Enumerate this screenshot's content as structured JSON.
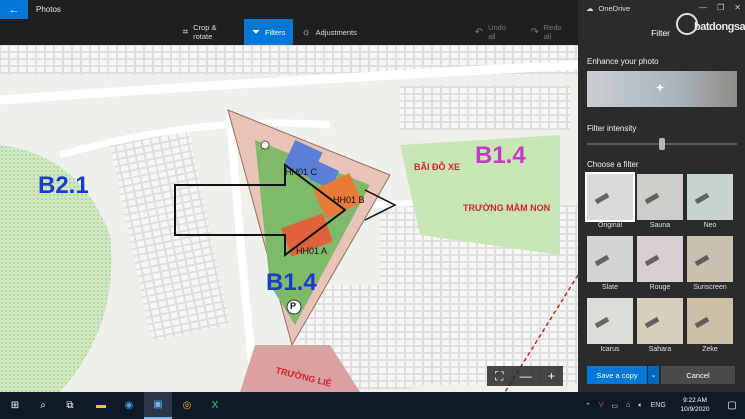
{
  "window": {
    "app_title": "Photos"
  },
  "toolbar": {
    "crop_label": "Crop & rotate",
    "filters_label": "Filters",
    "adjustments_label": "Adjustments",
    "undo_label": "Undo all",
    "redo_label": "Redo all"
  },
  "map": {
    "label_b21": "B2.1",
    "label_b14_top": "B1.4",
    "label_b14_bottom": "B1.4",
    "parking": "BÃI ĐỖ XE",
    "school": "TRƯỜNG MẦM NON",
    "school_bottom": "TRƯỜNG LIÊ",
    "hh01c": "HH01 C",
    "hh01b": "HH01 B",
    "hh01a": "HH01 A",
    "parking_symbol": "P"
  },
  "zoom": {
    "fit": "⛶",
    "minus": "—",
    "plus": "+"
  },
  "panel": {
    "onedrive": "OneDrive",
    "title": "Filter",
    "watermark": "batdongsan",
    "enhance_label": "Enhance your photo",
    "intensity_label": "Filter intensity",
    "intensity_value": 0.5,
    "choose_label": "Choose a filter",
    "filters": [
      {
        "name": "Original",
        "selected": true,
        "tint": "#d8dbd9"
      },
      {
        "name": "Sauna",
        "selected": false,
        "tint": "#cfcdca"
      },
      {
        "name": "Neo",
        "selected": false,
        "tint": "#c9d3ce"
      },
      {
        "name": "Slate",
        "selected": false,
        "tint": "#d2d5d4"
      },
      {
        "name": "Rouge",
        "selected": false,
        "tint": "#d7cfd2"
      },
      {
        "name": "Sunscreen",
        "selected": false,
        "tint": "#c9c2b3"
      },
      {
        "name": "Icarus",
        "selected": false,
        "tint": "#dcdcd9"
      },
      {
        "name": "Sahara",
        "selected": false,
        "tint": "#d6cfbe"
      },
      {
        "name": "Zeke",
        "selected": false,
        "tint": "#cbbfa6"
      }
    ],
    "save_label": "Save a copy",
    "cancel_label": "Cancel"
  },
  "taskbar": {
    "language": "ENG",
    "time": "9:22 AM",
    "date": "10/9/2020"
  },
  "colors": {
    "accent": "#0078d7",
    "panel_bg": "#2b2b2b",
    "map_green": "#9fcf8a",
    "building_orange": "#e77b3a",
    "building_blue": "#5a7fd6",
    "label_blue": "#1a3bd1",
    "label_magenta": "#c23bc5",
    "label_red": "#d4232b"
  }
}
